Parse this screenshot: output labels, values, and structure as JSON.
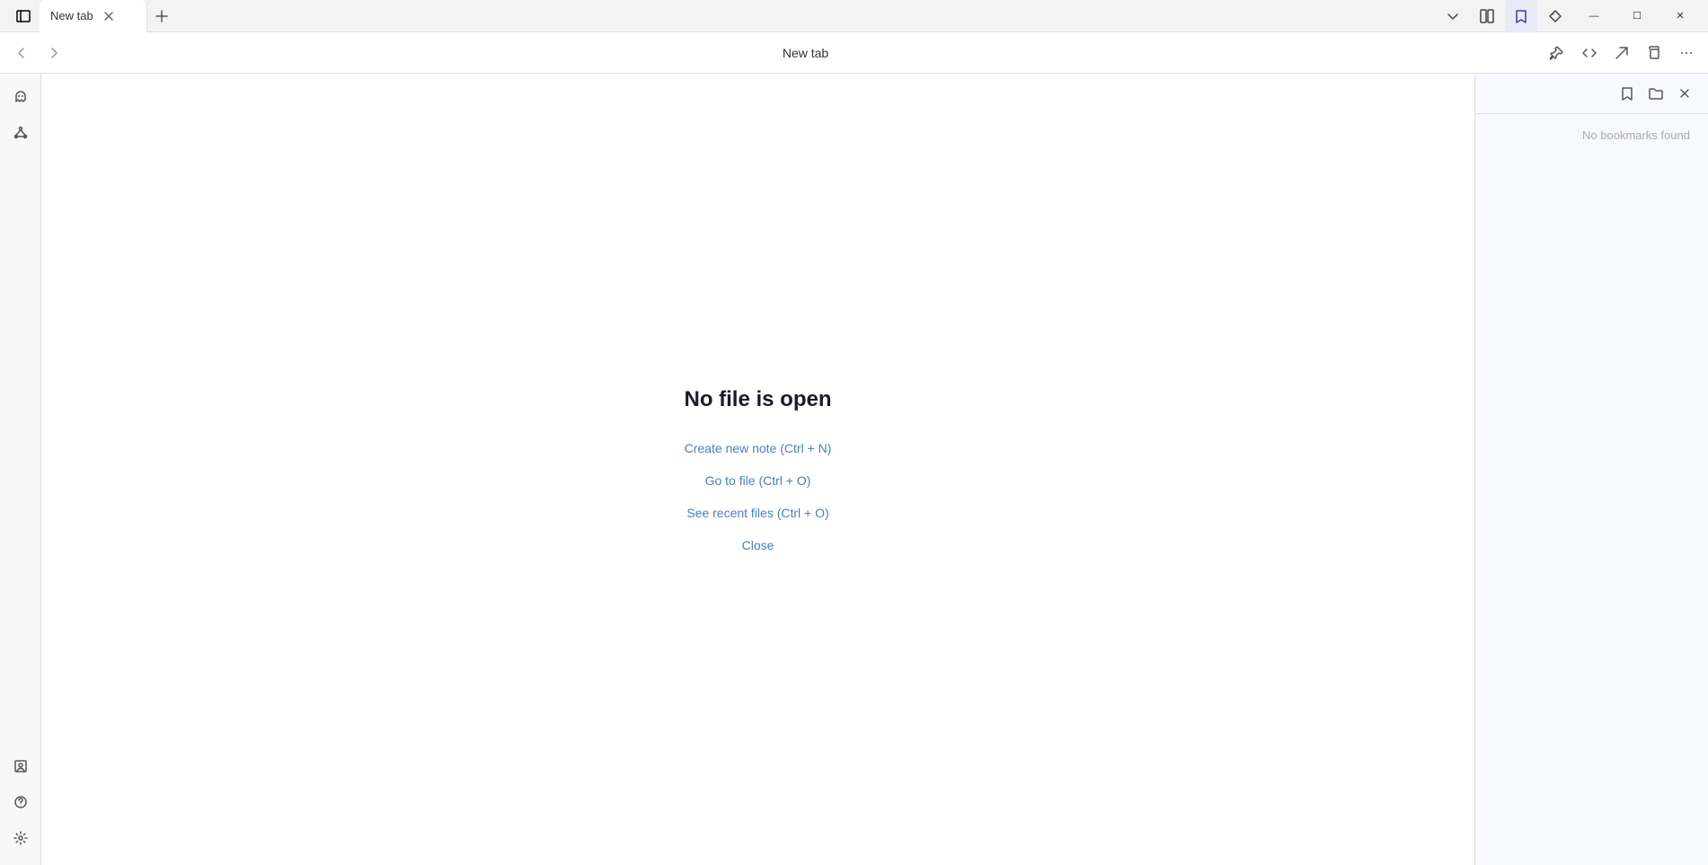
{
  "titlebar": {
    "tab_label": "New tab",
    "add_tab_label": "+",
    "chevron_down": "▾",
    "layout_icon": "⊞",
    "bookmark_icon": "🔖",
    "tag_icon": "◇",
    "minimize": "—",
    "maximize": "☐",
    "close": "✕"
  },
  "toolbar": {
    "back_label": "←",
    "forward_label": "→",
    "title": "New tab",
    "pin_icon": "📌",
    "code_icon": "<>",
    "send_icon": "➤",
    "copy_icon": "⧉",
    "more_icon": "⋯"
  },
  "sidebar": {
    "items": [
      {
        "name": "ghost-icon",
        "label": "👻"
      },
      {
        "name": "network-icon",
        "label": "⎔"
      }
    ],
    "bottom_items": [
      {
        "name": "bookmark-sidebar-icon",
        "label": "⊙"
      },
      {
        "name": "help-icon",
        "label": "?"
      },
      {
        "name": "settings-icon",
        "label": "⚙"
      }
    ]
  },
  "main": {
    "no_file_title": "No file is open",
    "actions": [
      {
        "label": "Create new note (Ctrl + N)",
        "name": "create-new-note-link"
      },
      {
        "label": "Go to file (Ctrl + O)",
        "name": "go-to-file-link"
      },
      {
        "label": "See recent files (Ctrl + O)",
        "name": "see-recent-files-link"
      },
      {
        "label": "Close",
        "name": "close-link"
      }
    ]
  },
  "bookmarks": {
    "empty_message": "No bookmarks found",
    "header_buttons": [
      {
        "name": "bookmark-add-icon",
        "label": "🔖"
      },
      {
        "name": "bookmark-folder-icon",
        "label": "📁"
      },
      {
        "name": "bookmarks-close-icon",
        "label": "✕"
      }
    ]
  }
}
